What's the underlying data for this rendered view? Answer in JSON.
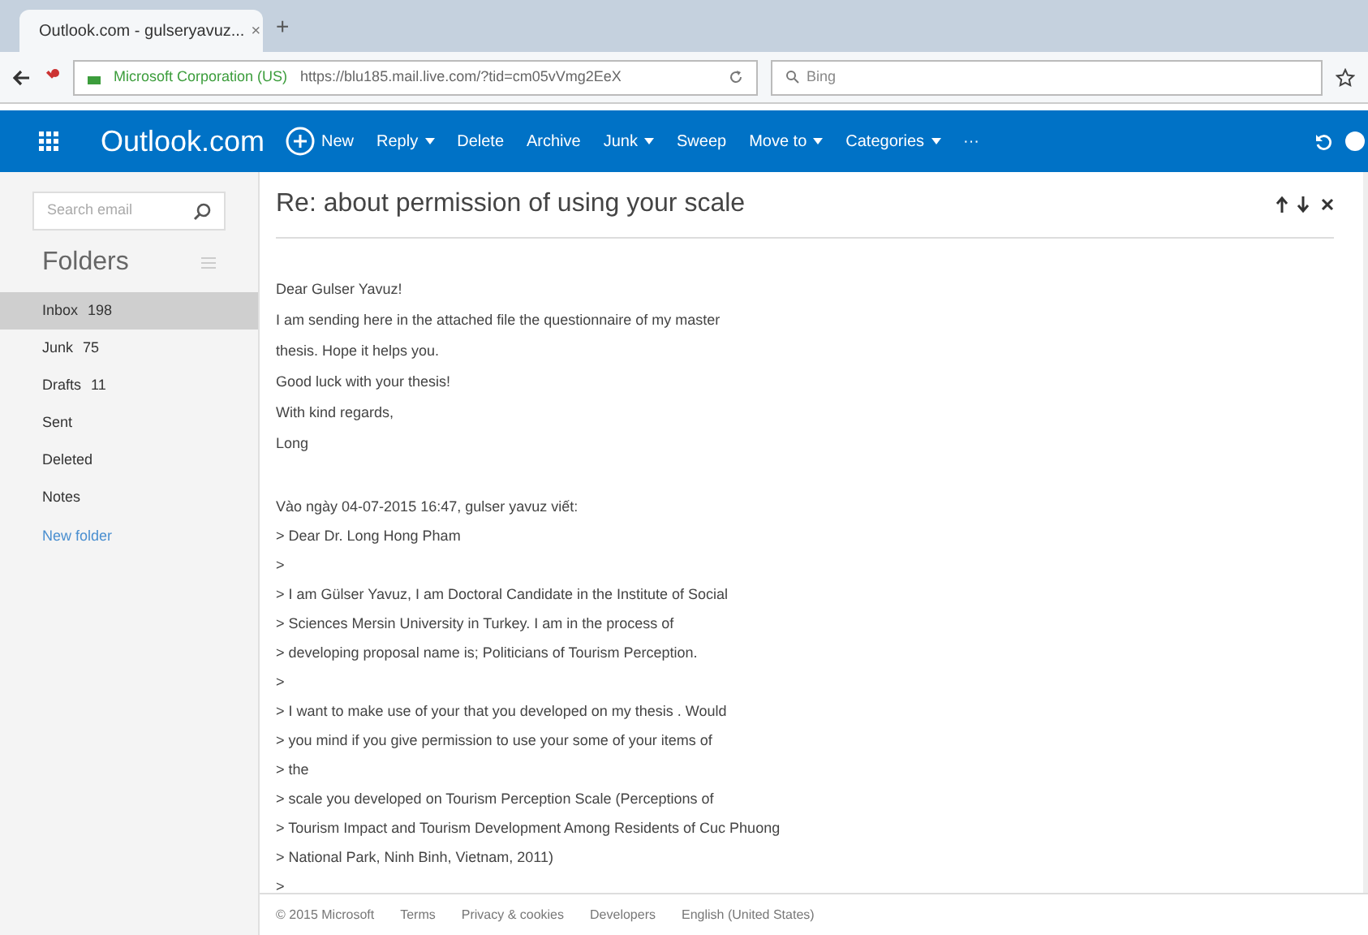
{
  "browser": {
    "tab": {
      "title": "Outlook.com - gulseryavuz...",
      "close": "×"
    },
    "new_tab": "+",
    "identity": "Microsoft Corporation (US)",
    "url": "https://blu185.mail.live.com/?tid=cm05vVmg2EeX",
    "search_placeholder": "Bing"
  },
  "app_bar": {
    "brand": "Outlook.com",
    "commands": [
      {
        "label": "New",
        "kind": "new",
        "dropdown": false
      },
      {
        "label": "Reply",
        "kind": "text",
        "dropdown": true
      },
      {
        "label": "Delete",
        "kind": "text",
        "dropdown": false
      },
      {
        "label": "Archive",
        "kind": "text",
        "dropdown": false
      },
      {
        "label": "Junk",
        "kind": "text",
        "dropdown": true
      },
      {
        "label": "Sweep",
        "kind": "text",
        "dropdown": false
      },
      {
        "label": "Move to",
        "kind": "text",
        "dropdown": true
      },
      {
        "label": "Categories",
        "kind": "text",
        "dropdown": true
      },
      {
        "label": "···",
        "kind": "text",
        "dropdown": false
      }
    ]
  },
  "sidebar": {
    "search_placeholder": "Search email",
    "heading": "Folders",
    "folders": [
      {
        "name": "Inbox",
        "count": "198",
        "selected": true
      },
      {
        "name": "Junk",
        "count": "75",
        "selected": false
      },
      {
        "name": "Drafts",
        "count": "11",
        "selected": false
      },
      {
        "name": "Sent",
        "selected": false
      },
      {
        "name": "Deleted",
        "selected": false
      },
      {
        "name": "Notes",
        "selected": false
      }
    ],
    "new_folder": "New folder"
  },
  "message": {
    "subject": "Re: about permission of using your scale",
    "body": [
      "Dear Gulser Yavuz!",
      "I am sending here in the attached file the questionnaire of my master",
      "thesis. Hope it helps you.",
      "Good luck with your thesis!",
      "With kind regards,",
      "Long"
    ],
    "quote_header": "Vào ngày 04-07-2015 16:47, gulser yavuz viết:",
    "quoted": [
      "> Dear Dr. Long Hong Pham",
      ">",
      "> I am Gülser Yavuz, I am Doctoral Candidate in the Institute of Social",
      "> Sciences Mersin University in Turkey. I am in the process of",
      "> developing proposal name is; Politicians of Tourism Perception.",
      ">",
      "> I want to make use of your that you developed on my thesis . Would",
      "> you mind if you give permission to use your some of your items of",
      "> the",
      "> scale you developed on Tourism Perception Scale (Perceptions of",
      "> Tourism Impact and Tourism Development Among Residents of Cuc Phuong",
      "> National Park, Ninh Binh, Vietnam, 2011)",
      ">"
    ]
  },
  "footer": [
    "© 2015 Microsoft",
    "Terms",
    "Privacy & cookies",
    "Developers",
    "English (United States)"
  ]
}
